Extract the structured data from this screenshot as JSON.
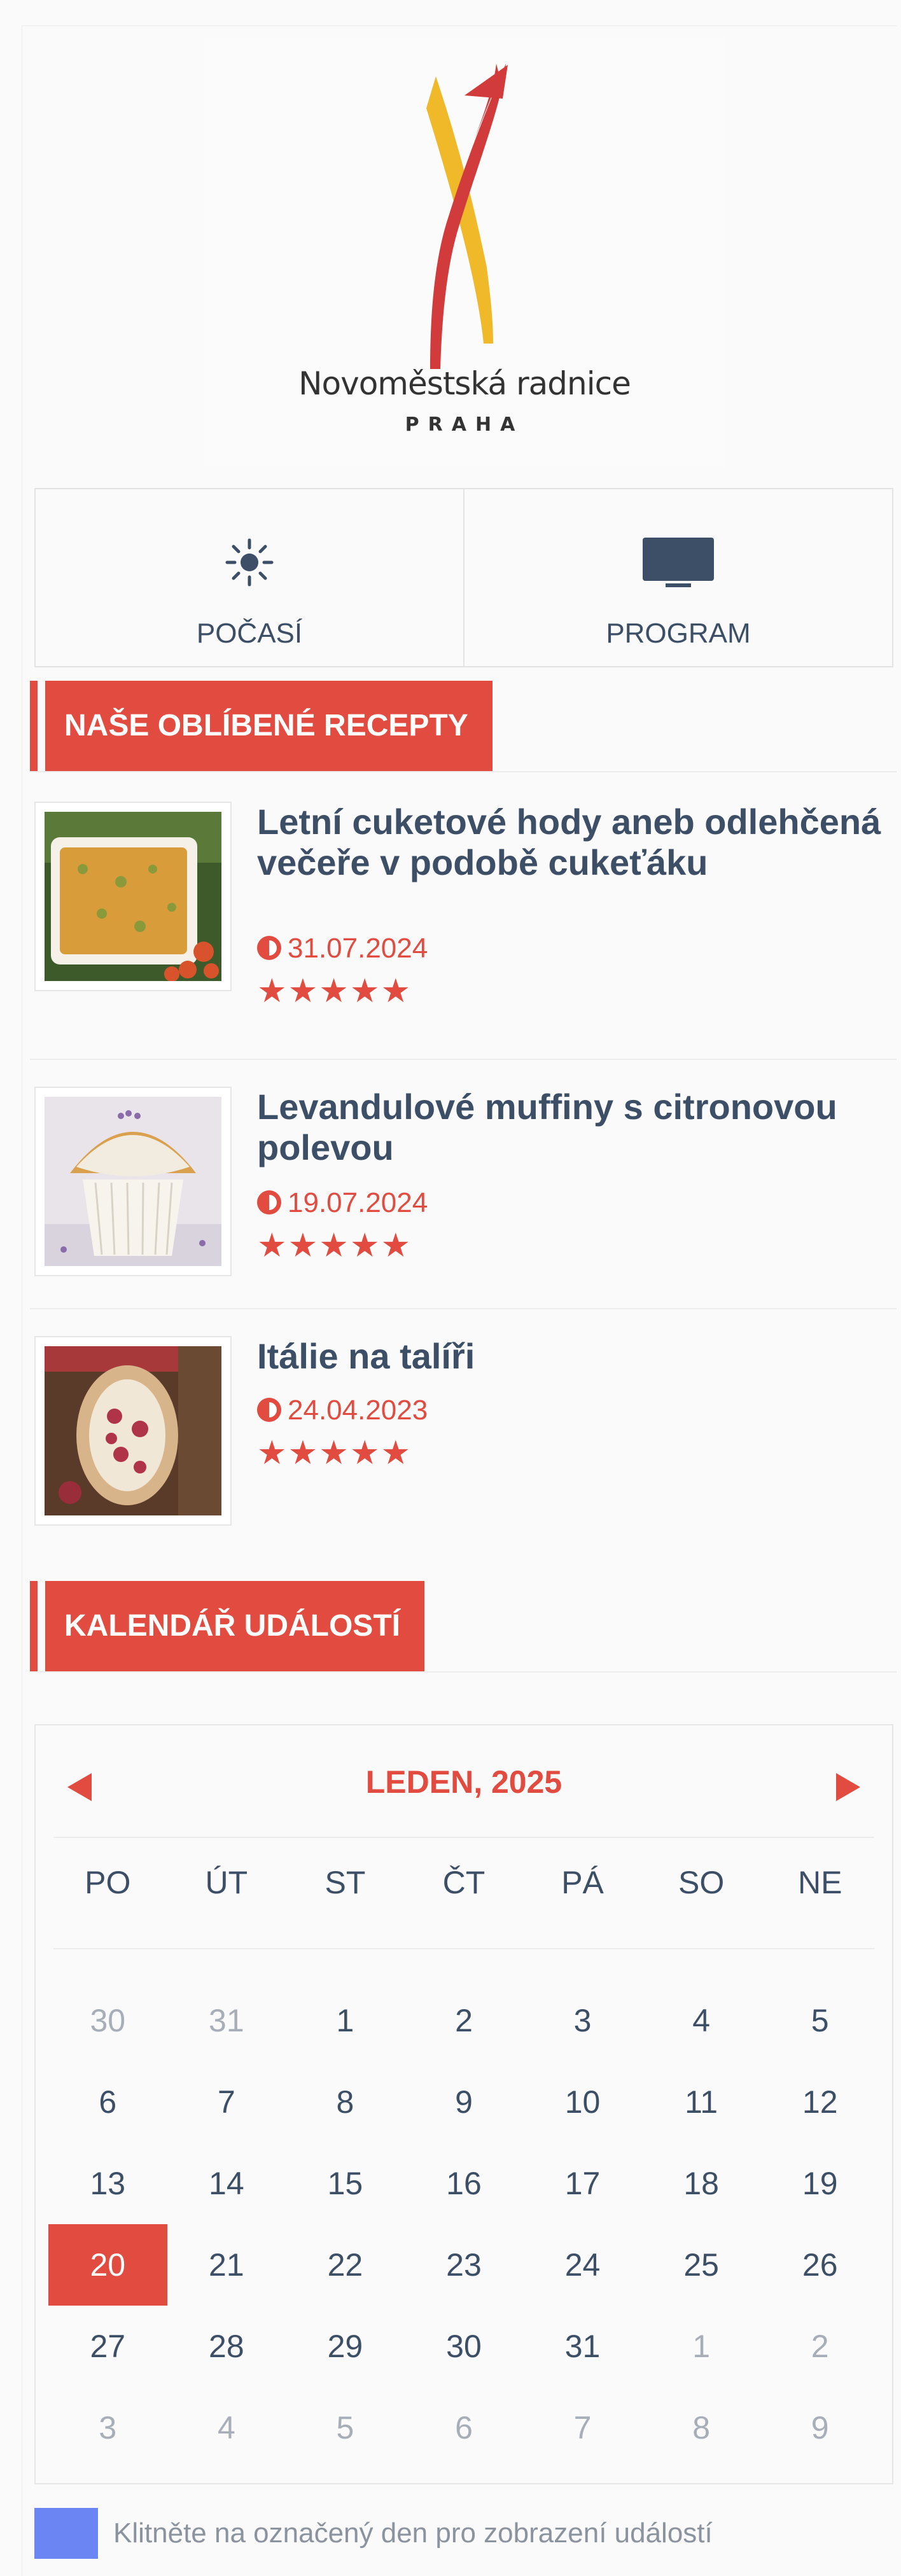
{
  "logo": {
    "name": "Novoměstská radnice",
    "city": "PRAHA",
    "colors": {
      "red": "#d23b3b",
      "yellow": "#f0b92a"
    }
  },
  "quick_links": [
    {
      "icon": "sun-icon",
      "label": "POČASÍ"
    },
    {
      "icon": "tv-icon",
      "label": "PROGRAM"
    }
  ],
  "recipes_section": {
    "title": "NAŠE OBLÍBENÉ RECEPTY",
    "items": [
      {
        "title": "Letní cuketové hody aneb odlehčená večeře v podobě cukeťáku",
        "date": "31.07.2024",
        "stars": "★★★★★"
      },
      {
        "title": "Levandulové muffiny s citronovou polevou",
        "date": "19.07.2024",
        "stars": "★★★★★"
      },
      {
        "title": "Itálie na talíři",
        "date": "24.04.2023",
        "stars": "★★★★★"
      }
    ]
  },
  "calendar_section": {
    "title": "KALENDÁŘ UDÁLOSTÍ",
    "month_label": "LEDEN, 2025",
    "weekdays": [
      "PO",
      "ÚT",
      "ST",
      "ČT",
      "PÁ",
      "SO",
      "NE"
    ],
    "days": [
      {
        "d": "30",
        "muted": true
      },
      {
        "d": "31",
        "muted": true
      },
      {
        "d": "1"
      },
      {
        "d": "2"
      },
      {
        "d": "3"
      },
      {
        "d": "4"
      },
      {
        "d": "5"
      },
      {
        "d": "6"
      },
      {
        "d": "7"
      },
      {
        "d": "8"
      },
      {
        "d": "9"
      },
      {
        "d": "10"
      },
      {
        "d": "11"
      },
      {
        "d": "12"
      },
      {
        "d": "13"
      },
      {
        "d": "14"
      },
      {
        "d": "15"
      },
      {
        "d": "16"
      },
      {
        "d": "17"
      },
      {
        "d": "18"
      },
      {
        "d": "19"
      },
      {
        "d": "20",
        "today": true
      },
      {
        "d": "21"
      },
      {
        "d": "22"
      },
      {
        "d": "23"
      },
      {
        "d": "24"
      },
      {
        "d": "25"
      },
      {
        "d": "26"
      },
      {
        "d": "27"
      },
      {
        "d": "28"
      },
      {
        "d": "29"
      },
      {
        "d": "30"
      },
      {
        "d": "31"
      },
      {
        "d": "1",
        "muted": true
      },
      {
        "d": "2",
        "muted": true
      },
      {
        "d": "3",
        "muted": true
      },
      {
        "d": "4",
        "muted": true
      },
      {
        "d": "5",
        "muted": true
      },
      {
        "d": "6",
        "muted": true
      },
      {
        "d": "7",
        "muted": true
      },
      {
        "d": "8",
        "muted": true
      },
      {
        "d": "9",
        "muted": true
      }
    ],
    "legend_text": "Klitněte na označený den pro zobrazení událostí",
    "legend_color": "#6b86f2",
    "accent": "#e24b3f"
  }
}
